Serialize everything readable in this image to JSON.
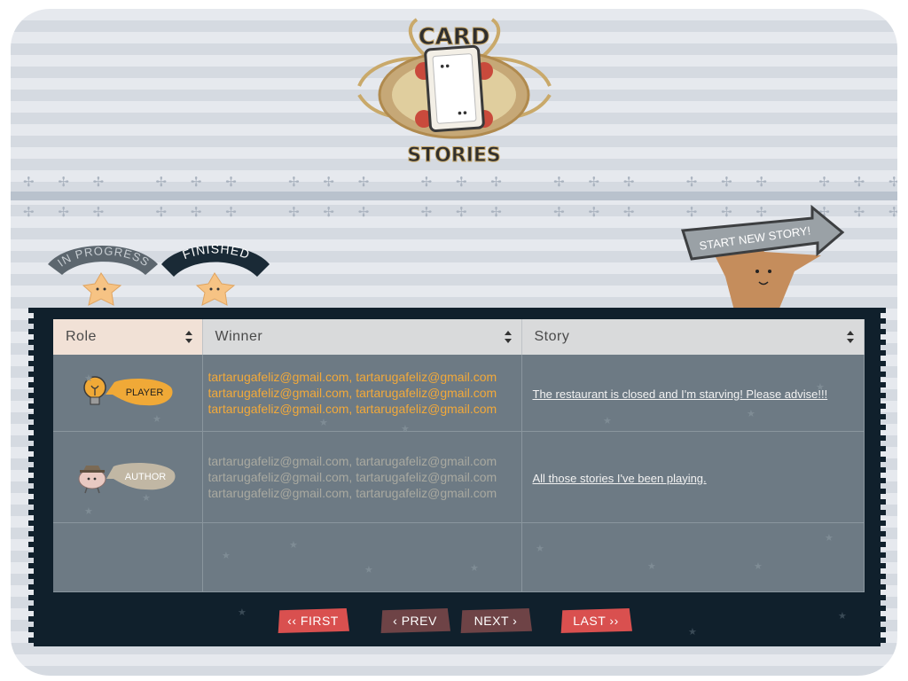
{
  "logo": {
    "line1": "CARD",
    "line2": "STORIES"
  },
  "tabs": [
    {
      "label": "IN PROGRESS",
      "state": "inactive"
    },
    {
      "label": "FINISHED",
      "state": "active"
    }
  ],
  "start_button": {
    "label": "START NEW STORY!"
  },
  "table": {
    "headers": {
      "role": "Role",
      "winner": "Winner",
      "story": "Story"
    },
    "rows": [
      {
        "role_badge": "PLAYER",
        "role_icon": "lightbulb-icon",
        "winners": [
          "tartarugafeliz@gmail.com, tartarugafeliz@gmail.com",
          "tartarugafeliz@gmail.com, tartarugafeliz@gmail.com",
          "tartarugafeliz@gmail.com, tartarugafeliz@gmail.com"
        ],
        "story": "The restaurant is closed and I'm starving! Please advise!!!"
      },
      {
        "role_badge": "AUTHOR",
        "role_icon": "brain-with-hat-icon",
        "winners": [
          "tartarugafeliz@gmail.com, tartarugafeliz@gmail.com",
          "tartarugafeliz@gmail.com, tartarugafeliz@gmail.com",
          "tartarugafeliz@gmail.com, tartarugafeliz@gmail.com"
        ],
        "story": "All those stories I've been playing."
      }
    ]
  },
  "pager": {
    "first": "‹‹ FIRST",
    "prev": "‹ PREV",
    "next": "NEXT ›",
    "last": "LAST ››"
  },
  "colors": {
    "accent_red": "#d9504f",
    "dark_red": "#6e4346",
    "board": "#10202c",
    "winner_orange": "#f2a93a"
  }
}
